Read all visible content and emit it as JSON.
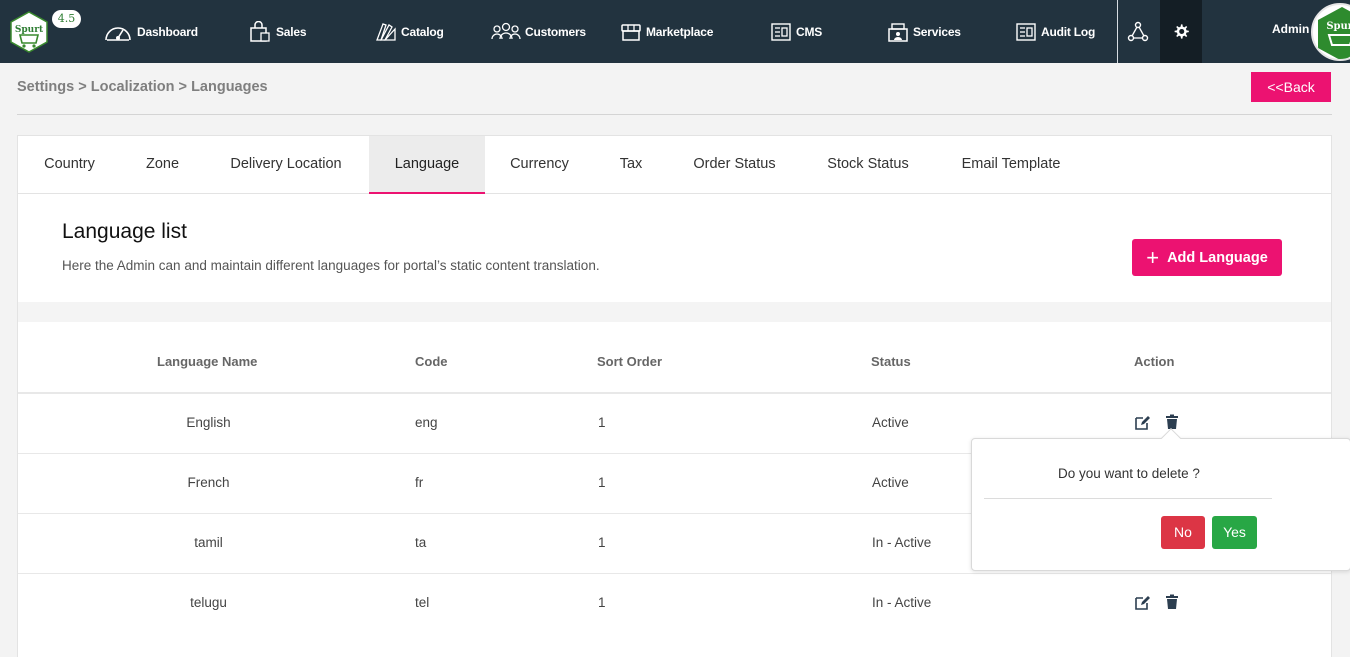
{
  "app": {
    "version": "4.5",
    "logo_text": "Spurt"
  },
  "nav": {
    "dashboard": "Dashboard",
    "sales": "Sales",
    "catalog": "Catalog",
    "customers": "Customers",
    "marketplace": "Marketplace",
    "cms": "CMS",
    "services": "Services",
    "audit_log": "Audit Log",
    "user": "Admin"
  },
  "breadcrumb": {
    "settings": "Settings",
    "localization": "Localization",
    "languages": "Languages",
    "separator": " > "
  },
  "back_label": "<<Back",
  "tabs": [
    "Country",
    "Zone",
    "Delivery Location",
    "Language",
    "Currency",
    "Tax",
    "Order Status",
    "Stock Status",
    "Email Template"
  ],
  "active_tab": "Language",
  "section": {
    "title": "Language list",
    "description": "Here the Admin can and maintain different languages for portal’s static content translation.",
    "add_button": "Add Language"
  },
  "table": {
    "headers": {
      "name": "Language Name",
      "code": "Code",
      "sort": "Sort Order",
      "status": "Status",
      "action": "Action"
    },
    "rows": [
      {
        "name": "English",
        "code": "eng",
        "sort": "1",
        "status": "Active"
      },
      {
        "name": "French",
        "code": "fr",
        "sort": "1",
        "status": "Active"
      },
      {
        "name": "tamil",
        "code": "ta",
        "sort": "1",
        "status": "In - Active"
      },
      {
        "name": "telugu",
        "code": "tel",
        "sort": "1",
        "status": "In - Active"
      }
    ]
  },
  "confirm": {
    "question": "Do you want to delete ?",
    "no": "No",
    "yes": "Yes"
  },
  "colors": {
    "topbar": "#22333f",
    "accent": "#ec1271",
    "danger": "#dc3545",
    "success": "#28a745"
  }
}
